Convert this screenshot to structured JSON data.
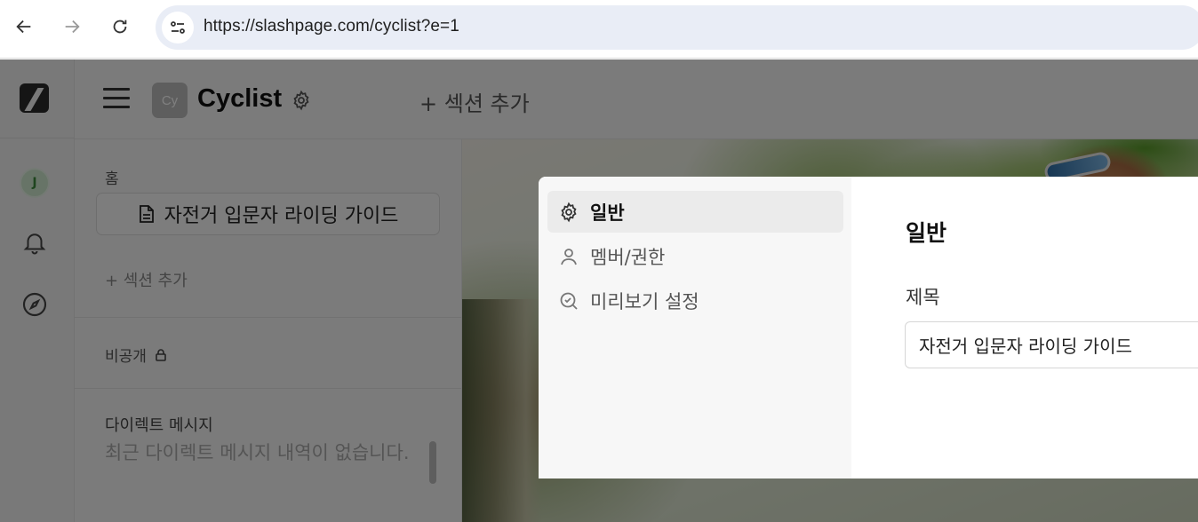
{
  "browser": {
    "url": "https://slashpage.com/cyclist?e=1",
    "icons": [
      "back-arrow-icon",
      "forward-arrow-icon",
      "reload-icon",
      "site-info-icon"
    ]
  },
  "rail": {
    "avatar_initial": "J",
    "icons": [
      "slashpage-logo-icon",
      "bell-icon",
      "compass-icon"
    ]
  },
  "topbar": {
    "space_badge": "Cy",
    "space_title": "Cyclist",
    "add_section": "+ 섹션 추가"
  },
  "sidebar": {
    "home_label": "홈",
    "home_page": "자전거 입문자 라이딩 가이드",
    "add_section": "+ 섹션 추가",
    "private_label": "비공개",
    "dm_title": "다이렉트 메시지",
    "dm_empty": "최근 다이렉트 메시지 내역이 없습니다."
  },
  "settings_modal": {
    "nav": [
      {
        "label": "일반",
        "icon": "gear-icon",
        "active": true
      },
      {
        "label": "멤버/권한",
        "icon": "person-icon",
        "active": false
      },
      {
        "label": "미리보기 설정",
        "icon": "preview-check-icon",
        "active": false
      }
    ],
    "section_title": "일반",
    "title_field_label": "제목",
    "title_field_value": "자전거 입문자 라이딩 가이드"
  },
  "colors": {
    "overlay": "rgba(0,0,0,0.5)",
    "urlbar_bg": "#e9edf6",
    "avatar_bg": "#cfe9cf"
  }
}
